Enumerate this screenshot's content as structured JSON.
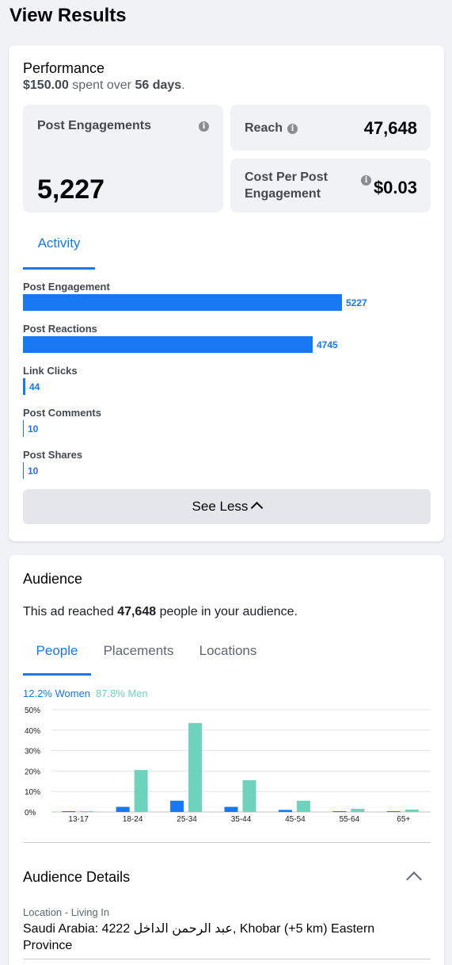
{
  "page_title": "View Results",
  "performance": {
    "title": "Performance",
    "spent": "$150.00",
    "spent_mid": " spent over ",
    "days": "56 days",
    "days_suffix": ".",
    "post_engagements_label": "Post Engagements",
    "post_engagements_value": "5,227",
    "reach_label": "Reach",
    "reach_value": "47,648",
    "cost_label": "Cost Per Post Engagement",
    "cost_value": "$0.03",
    "tab": "Activity",
    "see_less": "See Less",
    "metrics": [
      {
        "label": "Post Engagement",
        "value": 5227
      },
      {
        "label": "Post Reactions",
        "value": 4745
      },
      {
        "label": "Link Clicks",
        "value": 44
      },
      {
        "label": "Post Comments",
        "value": 10
      },
      {
        "label": "Post Shares",
        "value": 10
      }
    ]
  },
  "audience": {
    "title": "Audience",
    "sub_prefix": "This ad reached ",
    "sub_count": "47,648",
    "sub_suffix": " people in your audience.",
    "tabs": [
      "People",
      "Placements",
      "Locations"
    ],
    "legend_women": "12.2% Women",
    "legend_men": "87.8% Men",
    "details_title": "Audience Details",
    "location_label": "Location - Living In",
    "location_value": "Saudi Arabia: 4222 عبد الرحمن الداخل, Khobar (+5 km) Eastern Province"
  },
  "colors": {
    "accent": "#1877f2",
    "men": "#6dd3bc",
    "women": "#1877f2"
  },
  "chart_data": {
    "type": "bar",
    "categories": [
      "13-17",
      "18-24",
      "25-34",
      "35-44",
      "45-54",
      "55-64",
      "65+"
    ],
    "series": [
      {
        "name": "Women",
        "values": [
          0.2,
          2.5,
          5.5,
          2.5,
          1.0,
          0.4,
          0.2
        ]
      },
      {
        "name": "Men",
        "values": [
          0.3,
          20.5,
          43.5,
          15.5,
          5.5,
          1.5,
          1.2
        ]
      }
    ],
    "ylim": [
      0,
      50
    ],
    "yticks": [
      "0%",
      "10%",
      "20%",
      "30%",
      "40%",
      "50%"
    ],
    "grid": true
  }
}
